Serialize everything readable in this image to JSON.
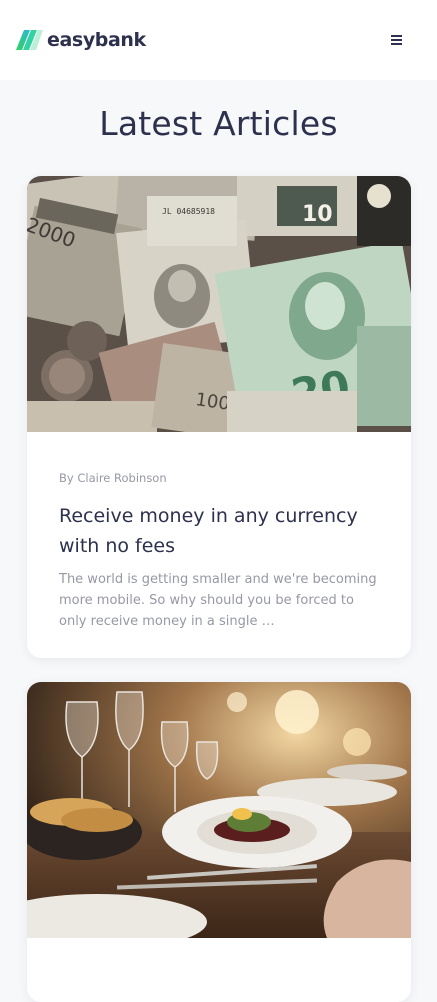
{
  "header": {
    "logo_text": "easybank",
    "menu_icon": "hamburger-menu-icon"
  },
  "section": {
    "title": "Latest Articles"
  },
  "articles": [
    {
      "author": "By Claire Robinson",
      "title": "Receive money in any currency with no fees",
      "excerpt": "The world is getting smaller and we're becoming more mobile. So why should you be forced to only receive money in a single …",
      "image_subject": "banknotes-photo"
    },
    {
      "image_subject": "restaurant-dinner-photo"
    }
  ],
  "colors": {
    "dark_blue": "#2d314d",
    "grayish_blue": "#9698a6",
    "background": "#f7f8fa",
    "lime_green": "#31d35c",
    "bright_cyan": "#2bb7da"
  }
}
